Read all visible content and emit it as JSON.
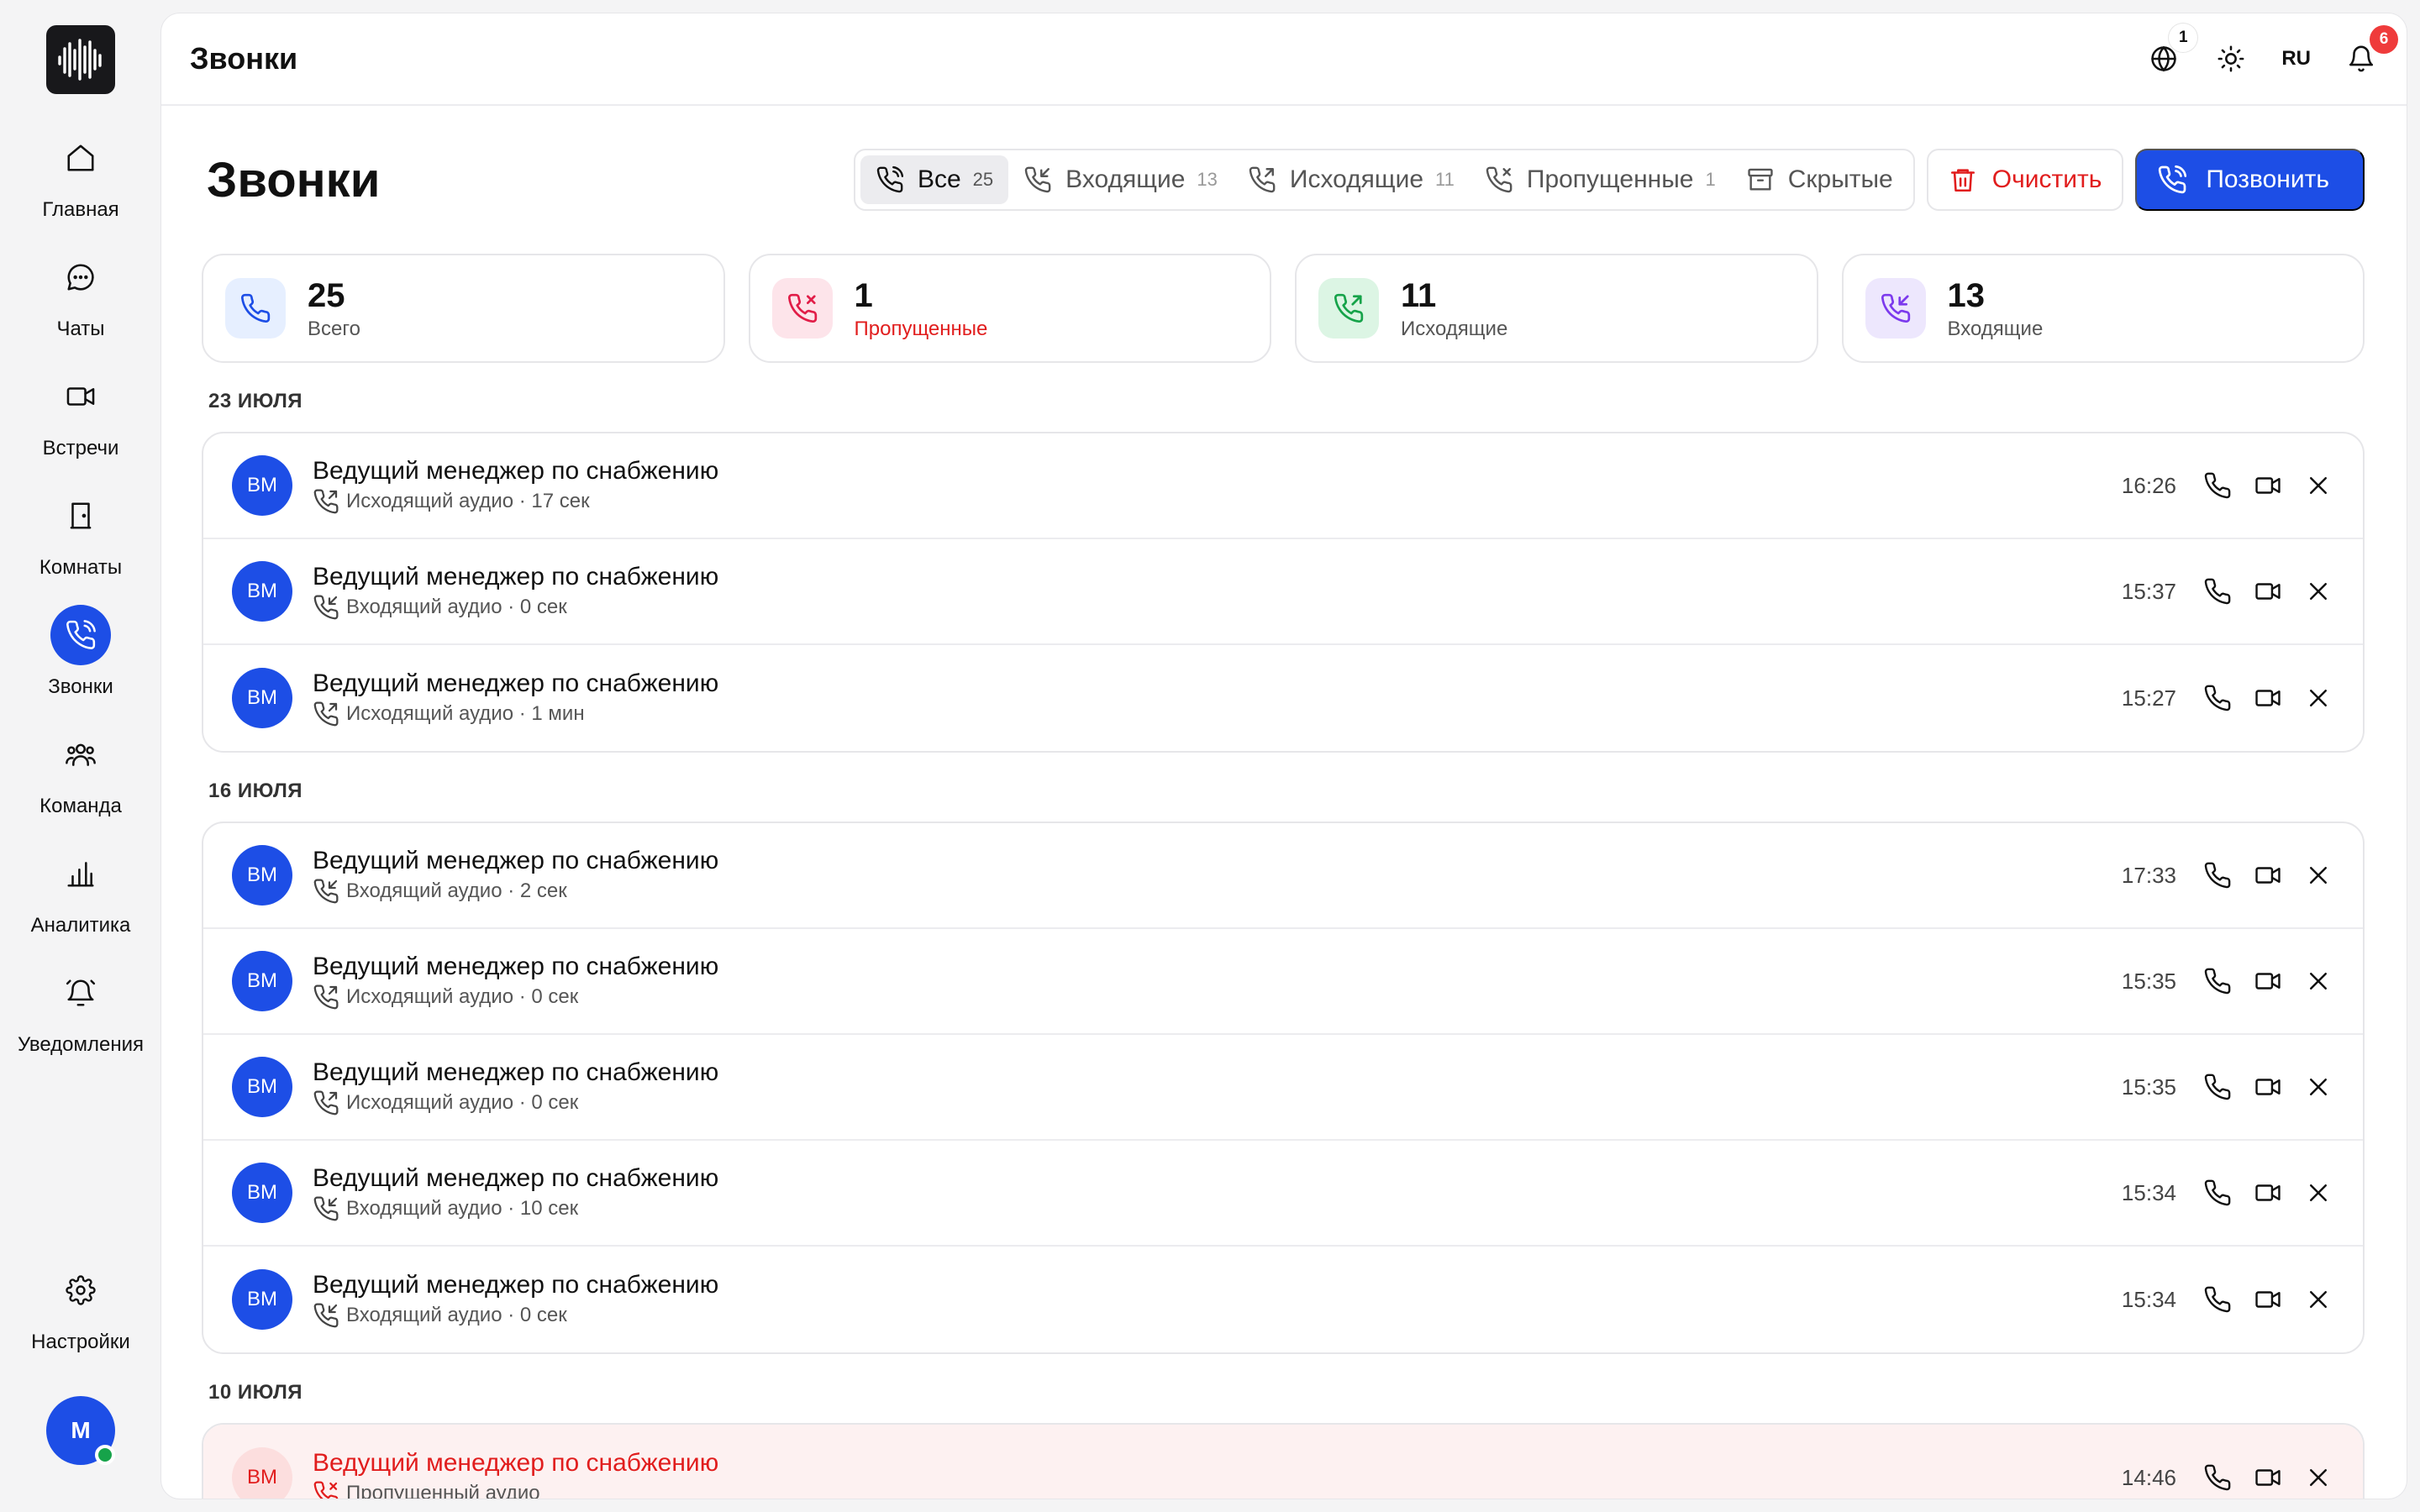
{
  "app": {
    "page_title": "Звонки"
  },
  "sidebar": {
    "items": [
      {
        "label": "Главная",
        "icon": "home-icon"
      },
      {
        "label": "Чаты",
        "icon": "chat-icon"
      },
      {
        "label": "Встречи",
        "icon": "video-icon"
      },
      {
        "label": "Комнаты",
        "icon": "door-icon"
      },
      {
        "label": "Звонки",
        "icon": "phone-icon",
        "active": true
      },
      {
        "label": "Команда",
        "icon": "team-icon"
      },
      {
        "label": "Аналитика",
        "icon": "analytics-icon"
      },
      {
        "label": "Уведомления",
        "icon": "bell-icon"
      }
    ],
    "settings_label": "Настройки",
    "user_initial": "M"
  },
  "topbar": {
    "title": "Звонки",
    "globe_badge": "1",
    "lang": "RU",
    "notif_badge": "6"
  },
  "header": {
    "title": "Звонки",
    "tabs": [
      {
        "label": "Все",
        "count": "25",
        "active": true
      },
      {
        "label": "Входящие",
        "count": "13"
      },
      {
        "label": "Исходящие",
        "count": "11"
      },
      {
        "label": "Пропущенные",
        "count": "1"
      },
      {
        "label": "Скрытые"
      }
    ],
    "clear_label": "Очистить",
    "call_label": "Позвонить"
  },
  "stats": [
    {
      "value": "25",
      "label": "Всего",
      "color": "#1d4ee6",
      "bg": "#e6efff"
    },
    {
      "value": "1",
      "label": "Пропущенные",
      "color": "#e11d48",
      "bg": "#fde4ea"
    },
    {
      "value": "11",
      "label": "Исходящие",
      "color": "#16a34a",
      "bg": "#dcf5e4"
    },
    {
      "value": "13",
      "label": "Входящие",
      "color": "#7c3aed",
      "bg": "#ede7fd"
    }
  ],
  "groups": [
    {
      "date": "23 ИЮЛЯ",
      "calls": [
        {
          "initials": "ВМ",
          "name": "Ведущий менеджер по снабжению",
          "sub": "Исходящий аудио · 17 сек",
          "time": "16:26",
          "dir": "out"
        },
        {
          "initials": "ВМ",
          "name": "Ведущий менеджер по снабжению",
          "sub": "Входящий аудио · 0 сек",
          "time": "15:37",
          "dir": "in"
        },
        {
          "initials": "ВМ",
          "name": "Ведущий менеджер по снабжению",
          "sub": "Исходящий аудио · 1 мин",
          "time": "15:27",
          "dir": "out"
        }
      ]
    },
    {
      "date": "16 ИЮЛЯ",
      "calls": [
        {
          "initials": "ВМ",
          "name": "Ведущий менеджер по снабжению",
          "sub": "Входящий аудио · 2 сек",
          "time": "17:33",
          "dir": "in"
        },
        {
          "initials": "ВМ",
          "name": "Ведущий менеджер по снабжению",
          "sub": "Исходящий аудио · 0 сек",
          "time": "15:35",
          "dir": "out"
        },
        {
          "initials": "ВМ",
          "name": "Ведущий менеджер по снабжению",
          "sub": "Исходящий аудио · 0 сек",
          "time": "15:35",
          "dir": "out"
        },
        {
          "initials": "ВМ",
          "name": "Ведущий менеджер по снабжению",
          "sub": "Входящий аудио · 10 сек",
          "time": "15:34",
          "dir": "in"
        },
        {
          "initials": "ВМ",
          "name": "Ведущий менеджер по снабжению",
          "sub": "Входящий аудио · 0 сек",
          "time": "15:34",
          "dir": "in"
        }
      ]
    },
    {
      "date": "10 ИЮЛЯ",
      "calls": [
        {
          "initials": "ВМ",
          "name": "Ведущий менеджер по снабжению",
          "sub": "Пропущенный аудио",
          "time": "14:46",
          "dir": "missed"
        }
      ]
    }
  ]
}
